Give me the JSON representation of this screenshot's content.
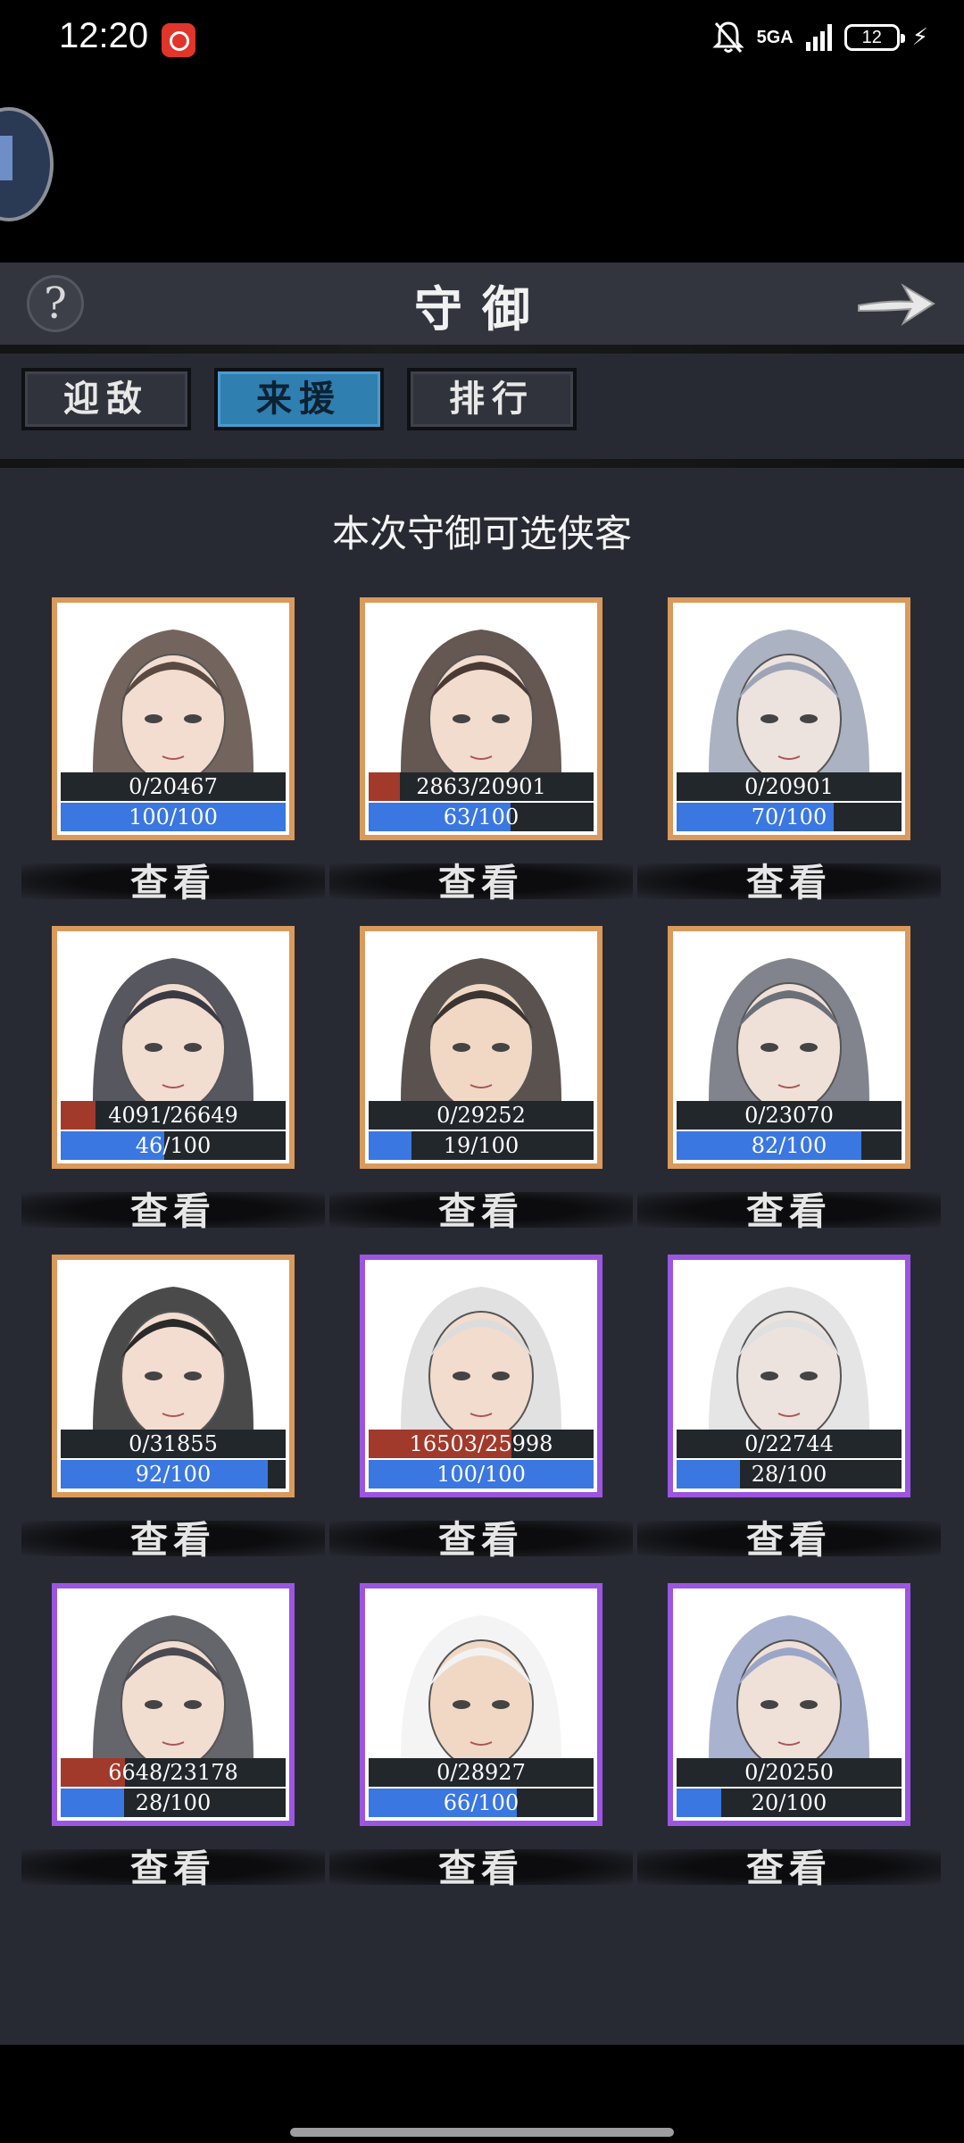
{
  "status_bar": {
    "time": "12:20",
    "network": "5GA",
    "battery": "12"
  },
  "header": {
    "title": "守御",
    "help_symbol": "?"
  },
  "tabs": [
    {
      "label": "迎敌",
      "active": false
    },
    {
      "label": "来援",
      "active": true
    },
    {
      "label": "排行",
      "active": false
    }
  ],
  "subtitle": "本次守御可选侠客",
  "view_label": "查看",
  "colors": {
    "border_orange": "#d99a5b",
    "border_purple": "#9b55e0",
    "hp_fill": "#a23a2c",
    "energy_fill": "#3a77e0",
    "active_tab": "#2f7fb0"
  },
  "heroes": [
    {
      "hp": "0/20467",
      "hp_frac": 0,
      "energy": "100/100",
      "energy_frac": 1.0,
      "rarity": "orange",
      "icon": "hero-portrait-icon"
    },
    {
      "hp": "2863/20901",
      "hp_frac": 0.137,
      "energy": "63/100",
      "energy_frac": 0.63,
      "rarity": "orange",
      "icon": "hero-portrait-icon"
    },
    {
      "hp": "0/20901",
      "hp_frac": 0,
      "energy": "70/100",
      "energy_frac": 0.7,
      "rarity": "orange",
      "icon": "hero-portrait-icon"
    },
    {
      "hp": "4091/26649",
      "hp_frac": 0.154,
      "energy": "46/100",
      "energy_frac": 0.46,
      "rarity": "orange",
      "icon": "hero-portrait-icon"
    },
    {
      "hp": "0/29252",
      "hp_frac": 0,
      "energy": "19/100",
      "energy_frac": 0.19,
      "rarity": "orange",
      "icon": "hero-portrait-icon"
    },
    {
      "hp": "0/23070",
      "hp_frac": 0,
      "energy": "82/100",
      "energy_frac": 0.82,
      "rarity": "orange",
      "icon": "hero-portrait-icon"
    },
    {
      "hp": "0/31855",
      "hp_frac": 0,
      "energy": "92/100",
      "energy_frac": 0.92,
      "rarity": "orange",
      "icon": "hero-portrait-icon"
    },
    {
      "hp": "16503/25998",
      "hp_frac": 0.635,
      "energy": "100/100",
      "energy_frac": 1.0,
      "rarity": "purple",
      "icon": "hero-portrait-icon"
    },
    {
      "hp": "0/22744",
      "hp_frac": 0,
      "energy": "28/100",
      "energy_frac": 0.28,
      "rarity": "purple",
      "icon": "hero-portrait-icon"
    },
    {
      "hp": "6648/23178",
      "hp_frac": 0.287,
      "energy": "28/100",
      "energy_frac": 0.28,
      "rarity": "purple",
      "icon": "hero-portrait-icon"
    },
    {
      "hp": "0/28927",
      "hp_frac": 0,
      "energy": "66/100",
      "energy_frac": 0.66,
      "rarity": "purple",
      "icon": "hero-portrait-icon"
    },
    {
      "hp": "0/20250",
      "hp_frac": 0,
      "energy": "20/100",
      "energy_frac": 0.2,
      "rarity": "purple",
      "icon": "hero-portrait-icon"
    }
  ]
}
